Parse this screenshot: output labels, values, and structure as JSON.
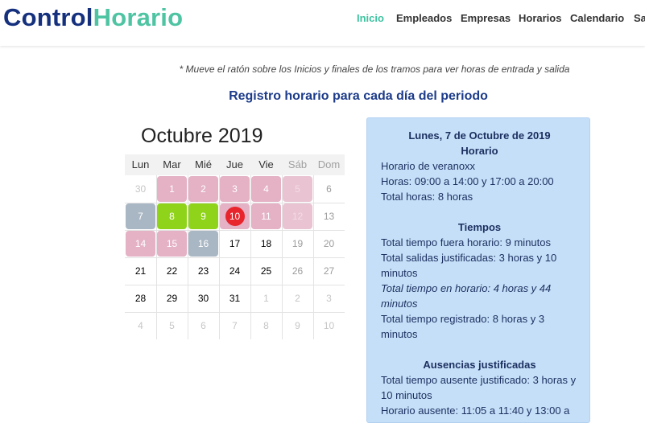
{
  "header": {
    "logo_part1": "Control",
    "logo_part2": "Horario",
    "nav": [
      {
        "label": "Inicio",
        "active": true
      },
      {
        "label": "Empleados",
        "active": false
      },
      {
        "label": "Empresas",
        "active": false
      },
      {
        "label": "Horarios",
        "active": false
      },
      {
        "label": "Calendario",
        "active": false
      },
      {
        "label": "Sa",
        "active": false
      }
    ]
  },
  "note": "* Mueve el ratón sobre los Inicios y finales de los tramos para ver horas de entrada y salida",
  "heading": "Registro horario para cada día del periodo",
  "calendar": {
    "month_title": "Octubre 2019",
    "weekdays": [
      "Lun",
      "Mar",
      "Mié",
      "Jue",
      "Vie",
      "Sáb",
      "Dom"
    ],
    "weeks": [
      [
        {
          "d": "30",
          "s": "other"
        },
        {
          "d": "1",
          "s": "pink"
        },
        {
          "d": "2",
          "s": "pink"
        },
        {
          "d": "3",
          "s": "pink"
        },
        {
          "d": "4",
          "s": "pink"
        },
        {
          "d": "5",
          "s": "pink we"
        },
        {
          "d": "6",
          "s": "we"
        }
      ],
      [
        {
          "d": "7",
          "s": "grey"
        },
        {
          "d": "8",
          "s": "green"
        },
        {
          "d": "9",
          "s": "green"
        },
        {
          "d": "10",
          "s": "pink todaycell"
        },
        {
          "d": "11",
          "s": "pink"
        },
        {
          "d": "12",
          "s": "pink we"
        },
        {
          "d": "13",
          "s": "we"
        }
      ],
      [
        {
          "d": "14",
          "s": "pink"
        },
        {
          "d": "15",
          "s": "pink"
        },
        {
          "d": "16",
          "s": "grey"
        },
        {
          "d": "17",
          "s": ""
        },
        {
          "d": "18",
          "s": ""
        },
        {
          "d": "19",
          "s": "we"
        },
        {
          "d": "20",
          "s": "we"
        }
      ],
      [
        {
          "d": "21",
          "s": ""
        },
        {
          "d": "22",
          "s": ""
        },
        {
          "d": "23",
          "s": ""
        },
        {
          "d": "24",
          "s": ""
        },
        {
          "d": "25",
          "s": ""
        },
        {
          "d": "26",
          "s": "we"
        },
        {
          "d": "27",
          "s": "we"
        }
      ],
      [
        {
          "d": "28",
          "s": ""
        },
        {
          "d": "29",
          "s": ""
        },
        {
          "d": "30",
          "s": ""
        },
        {
          "d": "31",
          "s": ""
        },
        {
          "d": "1",
          "s": "other"
        },
        {
          "d": "2",
          "s": "other"
        },
        {
          "d": "3",
          "s": "other"
        }
      ],
      [
        {
          "d": "4",
          "s": "other"
        },
        {
          "d": "5",
          "s": "other"
        },
        {
          "d": "6",
          "s": "other"
        },
        {
          "d": "7",
          "s": "other"
        },
        {
          "d": "8",
          "s": "other"
        },
        {
          "d": "9",
          "s": "other"
        },
        {
          "d": "10",
          "s": "other"
        }
      ]
    ]
  },
  "panel": {
    "date_title": "Lunes, 7 de Octubre de 2019",
    "horario_title": "Horario",
    "horario_name": "Horario de veranoxx",
    "horas": "Horas: 09:00 a 14:00 y 17:00 a 20:00",
    "total_horas": "Total horas: 8 horas",
    "tiempos_title": "Tiempos",
    "fuera_horario": "Total tiempo fuera horario: 9 minutos",
    "salidas_justificadas": "Total salidas justificadas: 3 horas y 10 minutos",
    "en_horario": "Total tiempo en horario: 4 horas y 44 minutos",
    "registrado": "Total tiempo registrado: 8 horas y 3 minutos",
    "ausencias_title": "Ausencias justificadas",
    "ausente_justificado": "Total tiempo ausente justificado: 3 horas y 10 minutos",
    "horario_ausente": "Horario ausente: 11:05 a 11:40 y 13:00 a"
  },
  "colors": {
    "brand_dark": "#15317e",
    "brand_green": "#4fc4a3",
    "pink": "#e4b1c5",
    "green": "#8fd41a",
    "grey": "#a9b6c3",
    "today": "#e8242c",
    "panel_bg": "#c5dff8"
  }
}
